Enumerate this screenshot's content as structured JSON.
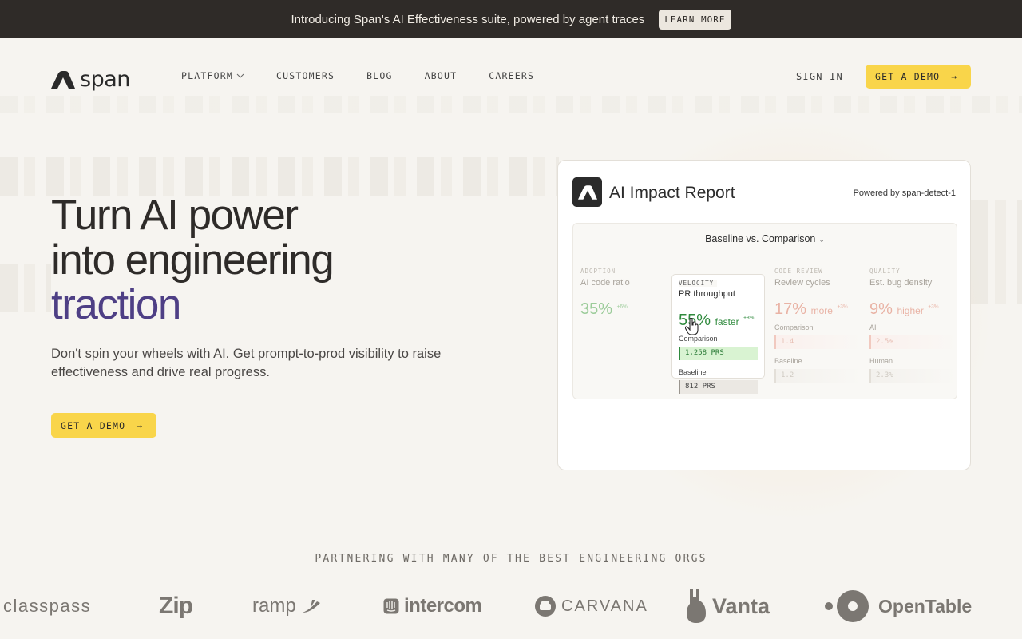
{
  "announcement": {
    "text": "Introducing Span's AI Effectiveness suite, powered by agent traces",
    "button": "LEARN MORE"
  },
  "nav": {
    "logo": "span",
    "items": [
      {
        "label": "PLATFORM",
        "has_dropdown": true
      },
      {
        "label": "CUSTOMERS"
      },
      {
        "label": "BLOG"
      },
      {
        "label": "ABOUT"
      },
      {
        "label": "CAREERS"
      }
    ],
    "sign_in": "SIGN IN",
    "demo": "GET A DEMO"
  },
  "hero": {
    "headline_line1": "Turn AI power",
    "headline_line2": "into engineering",
    "headline_accent": "traction",
    "subtext": "Don't spin your wheels with AI. Get prompt-to-prod visibility to raise effectiveness and drive real progress.",
    "cta": "GET A DEMO"
  },
  "report": {
    "title": "AI Impact Report",
    "powered_by": "Powered by span-detect-1",
    "comparison": "Baseline vs. Comparison",
    "metrics": {
      "adoption": {
        "category": "ADOPTION",
        "name": "AI code ratio",
        "value": "35%",
        "delta": "+6%"
      },
      "velocity": {
        "category": "VELOCITY",
        "name": "PR throughput",
        "value": "55%",
        "qualifier": "faster",
        "delta": "+8%",
        "sub1": "Comparison",
        "bar1": "1,258 PRS",
        "sub2": "Baseline",
        "bar2": "812 PRS"
      },
      "review": {
        "category": "CODE REVIEW",
        "name": "Review cycles",
        "value": "17%",
        "qualifier": "more",
        "delta": "+3%",
        "sub1": "Comparison",
        "bar1": "1.4",
        "sub2": "Baseline",
        "bar2": "1.2"
      },
      "quality": {
        "category": "QUALITY",
        "name": "Est. bug density",
        "value": "9%",
        "qualifier": "higher",
        "delta": "+3%",
        "sub1": "AI",
        "bar1": "2.5%",
        "sub2": "Human",
        "bar2": "2.3%"
      }
    }
  },
  "partners": {
    "label": "PARTNERING WITH MANY OF THE BEST ENGINEERING ORGS",
    "logos": [
      "classpass",
      "Zip",
      "ramp",
      "intercom",
      "CARVANA",
      "Vanta",
      "OpenTable"
    ]
  },
  "colors": {
    "accent_yellow": "#f9d54a",
    "accent_purple": "#4e3f85",
    "positive_green": "#2f8a3d",
    "dark_bar": "#2f2b28"
  }
}
